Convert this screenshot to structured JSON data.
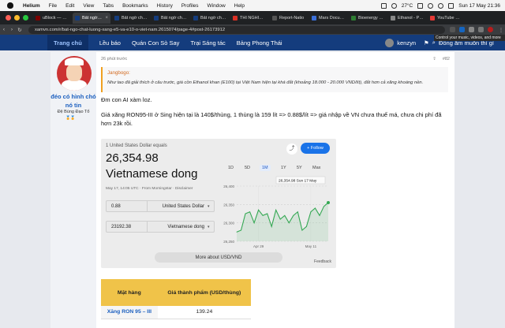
{
  "menubar": {
    "app": "Helium",
    "items": [
      "File",
      "Edit",
      "View",
      "Tabs",
      "Bookmarks",
      "History",
      "Profiles",
      "Window",
      "Help"
    ],
    "temp": "27°C",
    "clock": "Sun 17 May  21:36"
  },
  "tabs": [
    {
      "title": "uBlock — Das",
      "color": "#7a0000",
      "active": false
    },
    {
      "title": "Bất ngờ chất",
      "color": "#143c7d",
      "active": true
    },
    {
      "title": "Bất ngờ chất l",
      "color": "#143c7d",
      "active": false
    },
    {
      "title": "Bất ngờ chất l",
      "color": "#143c7d",
      "active": false
    },
    {
      "title": "Bất ngờ chất l",
      "color": "#143c7d",
      "active": false
    },
    {
      "title": "THÍ NGHIỆM (",
      "color": "#d93025",
      "active": false
    },
    {
      "title": "Report-Natio",
      "color": "#555555",
      "active": false
    },
    {
      "title": "Mars Docume",
      "color": "#3b6fd8",
      "active": false
    },
    {
      "title": "Bioenergy Re",
      "color": "#2e7d32",
      "active": false
    },
    {
      "title": "Ethanol - Prio",
      "color": "#888888",
      "active": false
    },
    {
      "title": "YouTube Music",
      "color": "#e53935",
      "active": false
    }
  ],
  "address": {
    "url": "xamvn.com/r/bat-ngo-chat-luong-xang-e5-va-e10-o-viet-nam.2615074/page-4#post-26173912",
    "tooltip": "Control your music, videos, and more"
  },
  "sitenav": {
    "items": [
      "Trang chủ",
      "Lều báo",
      "Quán Con Sò Say",
      "Trại Sáng tác",
      "Bảng Phong Thái"
    ],
    "username": "kenzyn",
    "cta": "Đồng âm muôn thì gì"
  },
  "post": {
    "author": "đéo có hình chó nó tin",
    "role": "Đệ Bùng Đạo Tổ",
    "time": "26 phút trước",
    "number": "#82",
    "quote_author": "Jangbogo:",
    "quote_text": "Như tao đã giải thích ở câu trước, giá cồn Ethanol khan (E100) tại Việt Nam hiện tại khá đắt (khoảng 18.000 - 20.000 VND/lít), đắt hơn cả xăng khoáng nền.",
    "line1": "Đm con AI xàm loz.",
    "line2": "Giá xăng RON95-III ở Sing hiện tại là 140$/thùng, 1 thùng là 159 lít => 0.88$/lít => giá nhập về VN chưa thuế má, chưa chi phí đã hơn 23k rồi."
  },
  "fx": {
    "caption": "1 United States Dollar equals",
    "value": "26,354.98",
    "currency": "Vietnamese dong",
    "date": "May 17, 14:05 UTC · From Morningstar · Disclaimer",
    "follow": "+ Follow",
    "ranges": [
      "1D",
      "5D",
      "1M",
      "1Y",
      "5Y",
      "Max"
    ],
    "selected_range": "1M",
    "input1_amount": "0.88",
    "input1_currency": "United States Dollar",
    "input2_amount": "23192.38",
    "input2_currency": "Vietnamese dong",
    "more": "More about USD/VND",
    "feedback": "Feedback",
    "tooltip": "26,354.98  Sun 17 May"
  },
  "chart_data": {
    "type": "line",
    "title": "",
    "xlabel": "",
    "ylabel": "",
    "y_ticks": [
      "26,400",
      "26,350",
      "26,300",
      "26,250"
    ],
    "ylim": [
      26250,
      26400
    ],
    "x_ticks": [
      "Apr 29",
      "May 11"
    ],
    "x_tick_positions": [
      5,
      17
    ],
    "values": [
      26275,
      26280,
      26325,
      26330,
      26300,
      26335,
      26320,
      26325,
      26290,
      26335,
      26310,
      26320,
      26300,
      26320,
      26330,
      26280,
      26290,
      26330,
      26340,
      26320,
      26345,
      26354.98
    ],
    "accent": "#34a853"
  },
  "table": {
    "headers": [
      "Mặt hàng",
      "Giá thành phẩm (USD/thùng)"
    ],
    "rows": [
      [
        "Xăng RON 95 – III",
        "139.24"
      ]
    ]
  }
}
